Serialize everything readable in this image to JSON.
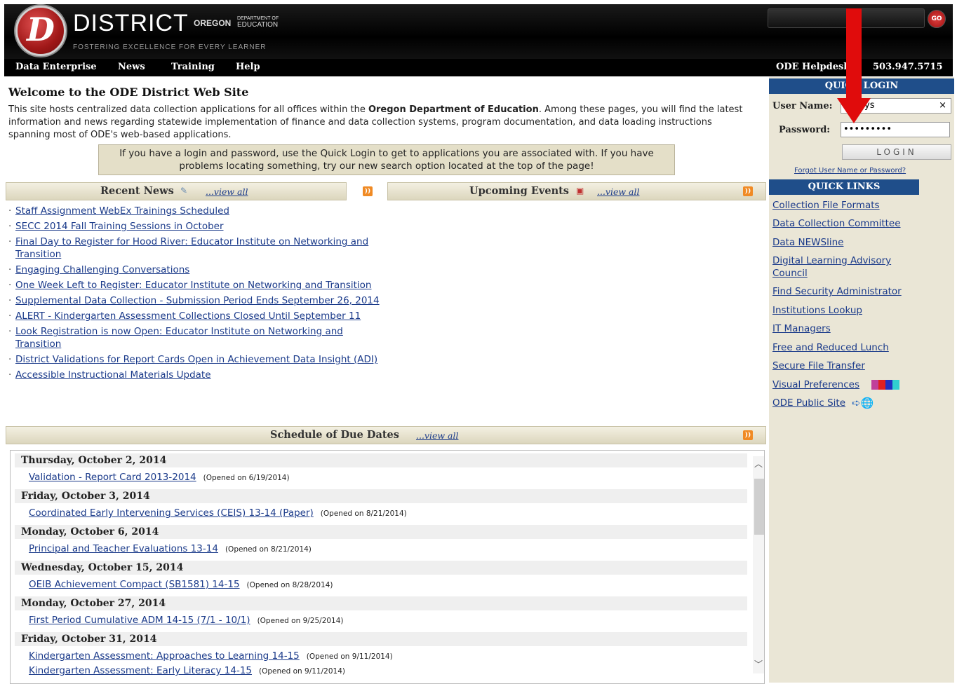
{
  "header": {
    "logo_letter": "D",
    "brand": "DISTRICT",
    "oregon": "OREGON",
    "ode_line1": "DEPARTMENT OF",
    "ode_line2": "EDUCATION",
    "tagline": "FOSTERING EXCELLENCE FOR EVERY LEARNER",
    "go_label": "GO"
  },
  "nav": {
    "items": [
      "Data Enterprise",
      "News",
      "Training",
      "Help"
    ],
    "helpdesk": "ODE Helpdesk",
    "phone": "503.947.5715"
  },
  "welcome": {
    "title": "Welcome to the ODE District Web Site",
    "intro_pre": "This site hosts centralized data collection applications for all offices within the ",
    "intro_bold": "Oregon Department of Education",
    "intro_post": ".  Among these pages, you will find the latest information and news regarding statewide implementation of finance and data collection systems, program documentation, and data loading instructions spanning most of ODE's web-based applications.",
    "notice": "If you have a login and password, use the Quick Login to get to applications you are associated with. If you have problems locating something, try our new search option located at the top of the page!"
  },
  "recent_news": {
    "title": "Recent News",
    "view_all": "...view all",
    "items": [
      "Staff Assignment WebEx Trainings Scheduled",
      "SECC 2014 Fall Training Sessions in October",
      "Final Day to Register for Hood River: Educator Institute on Networking and Transition",
      "Engaging Challenging Conversations",
      "One Week Left to Register: Educator Institute on Networking and Transition",
      "Supplemental Data Collection - Submission Period Ends September 26, 2014",
      "ALERT - Kindergarten Assessment Collections Closed Until September 11",
      "Look Registration is now Open: Educator Institute on Networking and Transition",
      "District Validations for Report Cards Open in Achievement Data Insight (ADI)",
      "Accessible Instructional Materials Update"
    ]
  },
  "events": {
    "title": "Upcoming Events",
    "view_all": "...view all"
  },
  "schedule": {
    "title": "Schedule of Due Dates",
    "view_all": "...view all",
    "days": [
      "Thursday, October 2, 2014",
      "Friday, October 3, 2014",
      "Monday, October 6, 2014",
      "Wednesday, October 15, 2014",
      "Monday, October 27, 2014",
      "Friday, October 31, 2014"
    ],
    "entries": [
      {
        "link": "Validation - Report Card 2013-2014",
        "opened": "(Opened on 6/19/2014)"
      },
      {
        "link": "Coordinated Early Intervening Services (CEIS) 13-14 (Paper)",
        "opened": "(Opened on 8/21/2014)"
      },
      {
        "link": "Principal and Teacher Evaluations 13-14",
        "opened": "(Opened on 8/21/2014)"
      },
      {
        "link": "OEIB Achievement Compact (SB1581) 14-15",
        "opened": "(Opened on 8/28/2014)"
      },
      {
        "link": "First Period Cumulative ADM 14-15 (7/1 - 10/1)",
        "opened": "(Opened on 9/25/2014)"
      },
      {
        "link": "Kindergarten Assessment: Approaches to Learning 14-15",
        "opened": "(Opened on 9/11/2014)"
      },
      {
        "link": "Kindergarten Assessment: Early Literacy 14-15",
        "opened": "(Opened on 9/11/2014)"
      }
    ]
  },
  "quick_login": {
    "title": "QUICK LOGIN",
    "username_label": "User Name:",
    "username_value": "ys",
    "clear_glyph": "×",
    "password_label": "Password:",
    "password_value": "•••••••••",
    "login_button": "LOGIN",
    "forgot": "Forgot User Name or Password?"
  },
  "quick_links": {
    "title": "QUICK LINKS",
    "items": [
      "Collection File Formats",
      "Data Collection Committee",
      "Data NEWSline",
      "Digital Learning Advisory Council",
      "Find Security Administrator",
      "Institutions Lookup",
      "IT Managers",
      "Free and Reduced Lunch",
      "Secure File Transfer",
      "Visual Preferences",
      "ODE Public Site"
    ]
  },
  "colors": {
    "accent_blue": "#1f4e8a",
    "annotation_red": "#e00c0c",
    "link": "#1a3a8a"
  }
}
